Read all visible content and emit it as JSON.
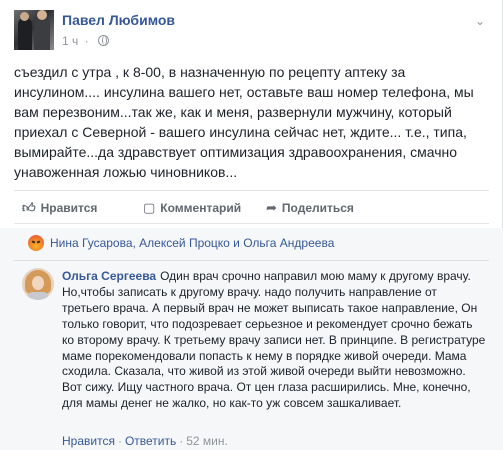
{
  "post": {
    "author": "Павел Любимов",
    "time": "1 ч",
    "text": "съездил с утра , к 8-00, в назначенную по рецепту аптеку за инсулином.... инсулина вашего нет, оставьте ваш номер телефона, мы вам перезвоним...так же, как и меня, развернули мужчину, который приехал с Северной - вашего инсулина сейчас нет, ждите... т.е., типа, вымирайте...да здравствует оптимизация здравоохранения, смачно унавоженная ложью чиновников..."
  },
  "actions": {
    "like": "Нравится",
    "comment": "Комментарий",
    "share": "Поделиться"
  },
  "reactions": {
    "names": "Нина Гусарова, Алексей Процко и Ольга Андреева"
  },
  "comment": {
    "author": "Ольга Сергеева",
    "text": "Один врач срочно направил мою маму к другому врачу. Но,чтобы записать к другому врачу. надо получить направление от третьего врача. А первый врач не может выписать такое направление, Он только говорит, что подозревает серьезное и рекомендует срочно бежать ко второму врачу. К третьему врачу записи нет. В принципе. В регистратуре маме порекомендовали попасть к нему в порядке живой очереди. Мама сходила. Сказала, что живой из этой живой очереди выйти невозможно. Вот сижу. Ищу частного врача. От цен глаза расширились. Мне, конечно, для мамы денег не жалко, но как-то уж совсем зашкаливает.",
    "like": "Нравится",
    "reply": "Ответить",
    "time": "52 мин."
  },
  "icons": {
    "like": "thumbs-up-icon",
    "comment": "comment-bubble-icon",
    "share": "share-arrow-icon",
    "privacy": "globe-icon",
    "menu": "chevron-down-icon",
    "reaction": "angry-reaction-icon"
  },
  "colors": {
    "link": "#365899",
    "text": "#1d2129",
    "meta": "#90949c",
    "comments_bg": "#f6f7f9"
  }
}
